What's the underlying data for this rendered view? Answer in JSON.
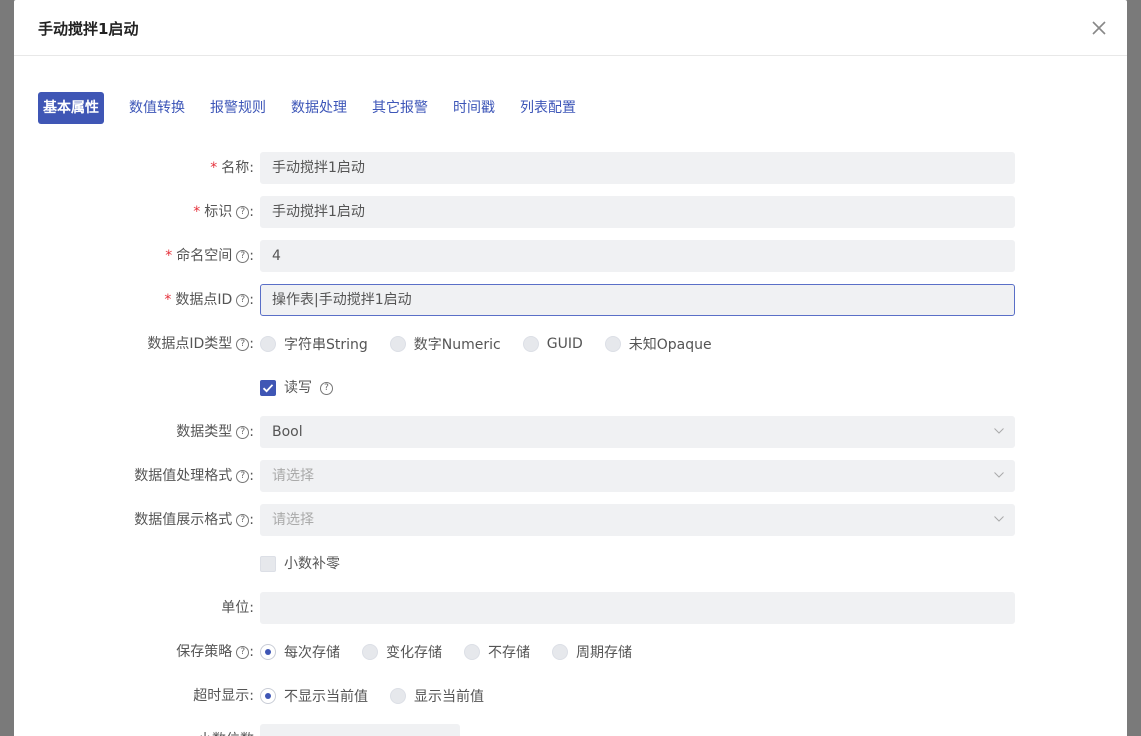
{
  "modal": {
    "title": "手动搅拌1启动"
  },
  "tabs": [
    {
      "label": "基本属性",
      "active": true
    },
    {
      "label": "数值转换"
    },
    {
      "label": "报警规则"
    },
    {
      "label": "数据处理"
    },
    {
      "label": "其它报警"
    },
    {
      "label": "时间戳"
    },
    {
      "label": "列表配置"
    }
  ],
  "form": {
    "name": {
      "label": "名称:",
      "value": "手动搅拌1启动"
    },
    "identifier": {
      "label": "标识",
      "value": "手动搅拌1启动"
    },
    "namespace": {
      "label": "命名空间",
      "value": "4"
    },
    "datapoint_id": {
      "label": "数据点ID",
      "value": "操作表|手动搅拌1启动"
    },
    "datapoint_id_type": {
      "label": "数据点ID类型",
      "options": [
        "字符串String",
        "数字Numeric",
        "GUID",
        "未知Opaque"
      ]
    },
    "readwrite": {
      "label": "读写",
      "checked": true
    },
    "data_type": {
      "label": "数据类型",
      "value": "Bool"
    },
    "value_process_format": {
      "label": "数据值处理格式",
      "placeholder": "请选择"
    },
    "value_display_format": {
      "label": "数据值展示格式",
      "placeholder": "请选择"
    },
    "decimal_pad": {
      "label": "小数补零",
      "checked": false
    },
    "unit": {
      "label": "单位:",
      "value": ""
    },
    "save_policy": {
      "label": "保存策略",
      "options": [
        "每次存储",
        "变化存储",
        "不存储",
        "周期存储"
      ],
      "selected": "每次存储"
    },
    "timeout_display": {
      "label": "超时显示:",
      "options": [
        "不显示当前值",
        "显示当前值"
      ],
      "selected": "不显示当前值"
    },
    "decimal_places": {
      "label": "小数位数"
    }
  },
  "colors": {
    "accent": "#3f56b5",
    "required": "#e5303a",
    "input_bg": "#f0f1f3"
  }
}
